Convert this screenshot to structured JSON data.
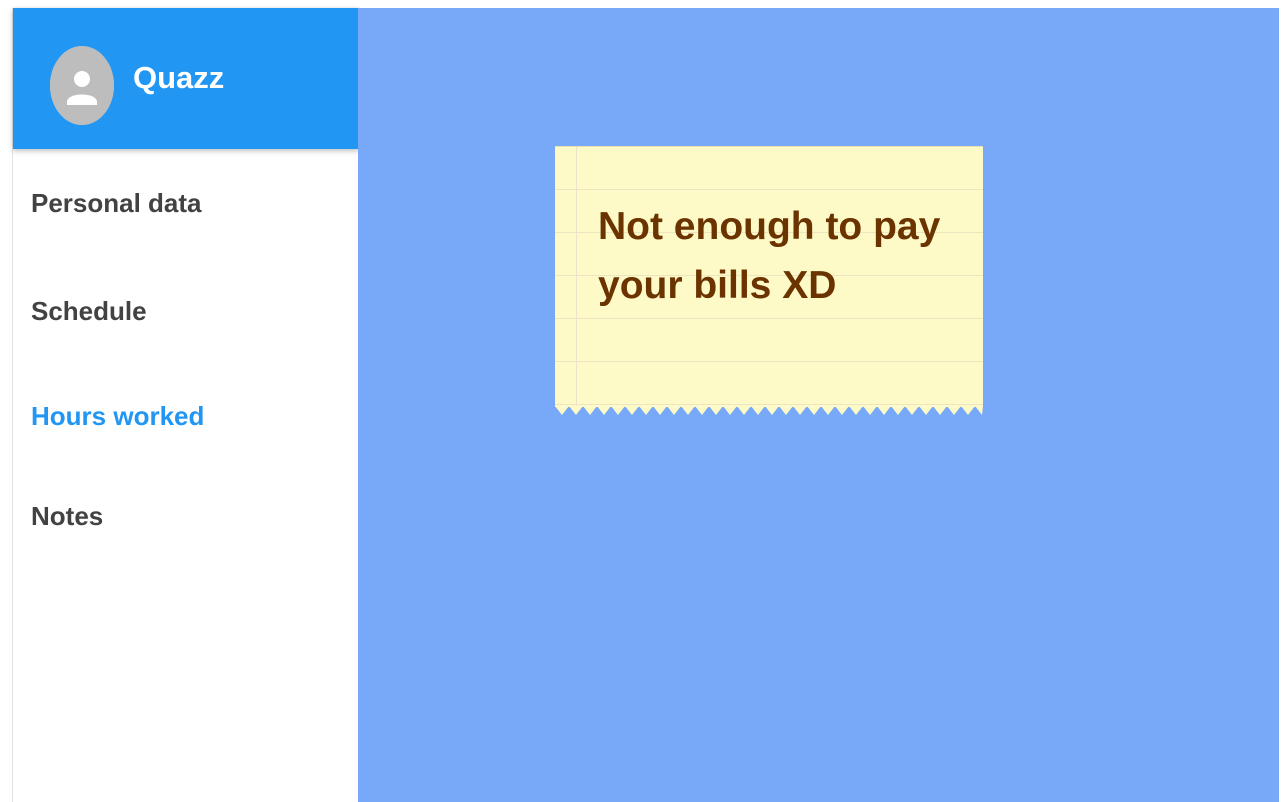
{
  "user": {
    "name": "Quazz",
    "avatar_icon": "person-icon"
  },
  "nav": {
    "items": [
      {
        "label": "Personal data",
        "active": false
      },
      {
        "label": "Schedule",
        "active": false
      },
      {
        "label": "Hours worked",
        "active": true
      },
      {
        "label": "Notes",
        "active": false
      }
    ]
  },
  "note": {
    "text": "Not enough to pay your bills XD"
  },
  "colors": {
    "header": "#2196f3",
    "active_nav": "#2196f3",
    "main_background": "#77a9f8",
    "note_paper": "#fefac8",
    "note_text": "#6a3300"
  }
}
